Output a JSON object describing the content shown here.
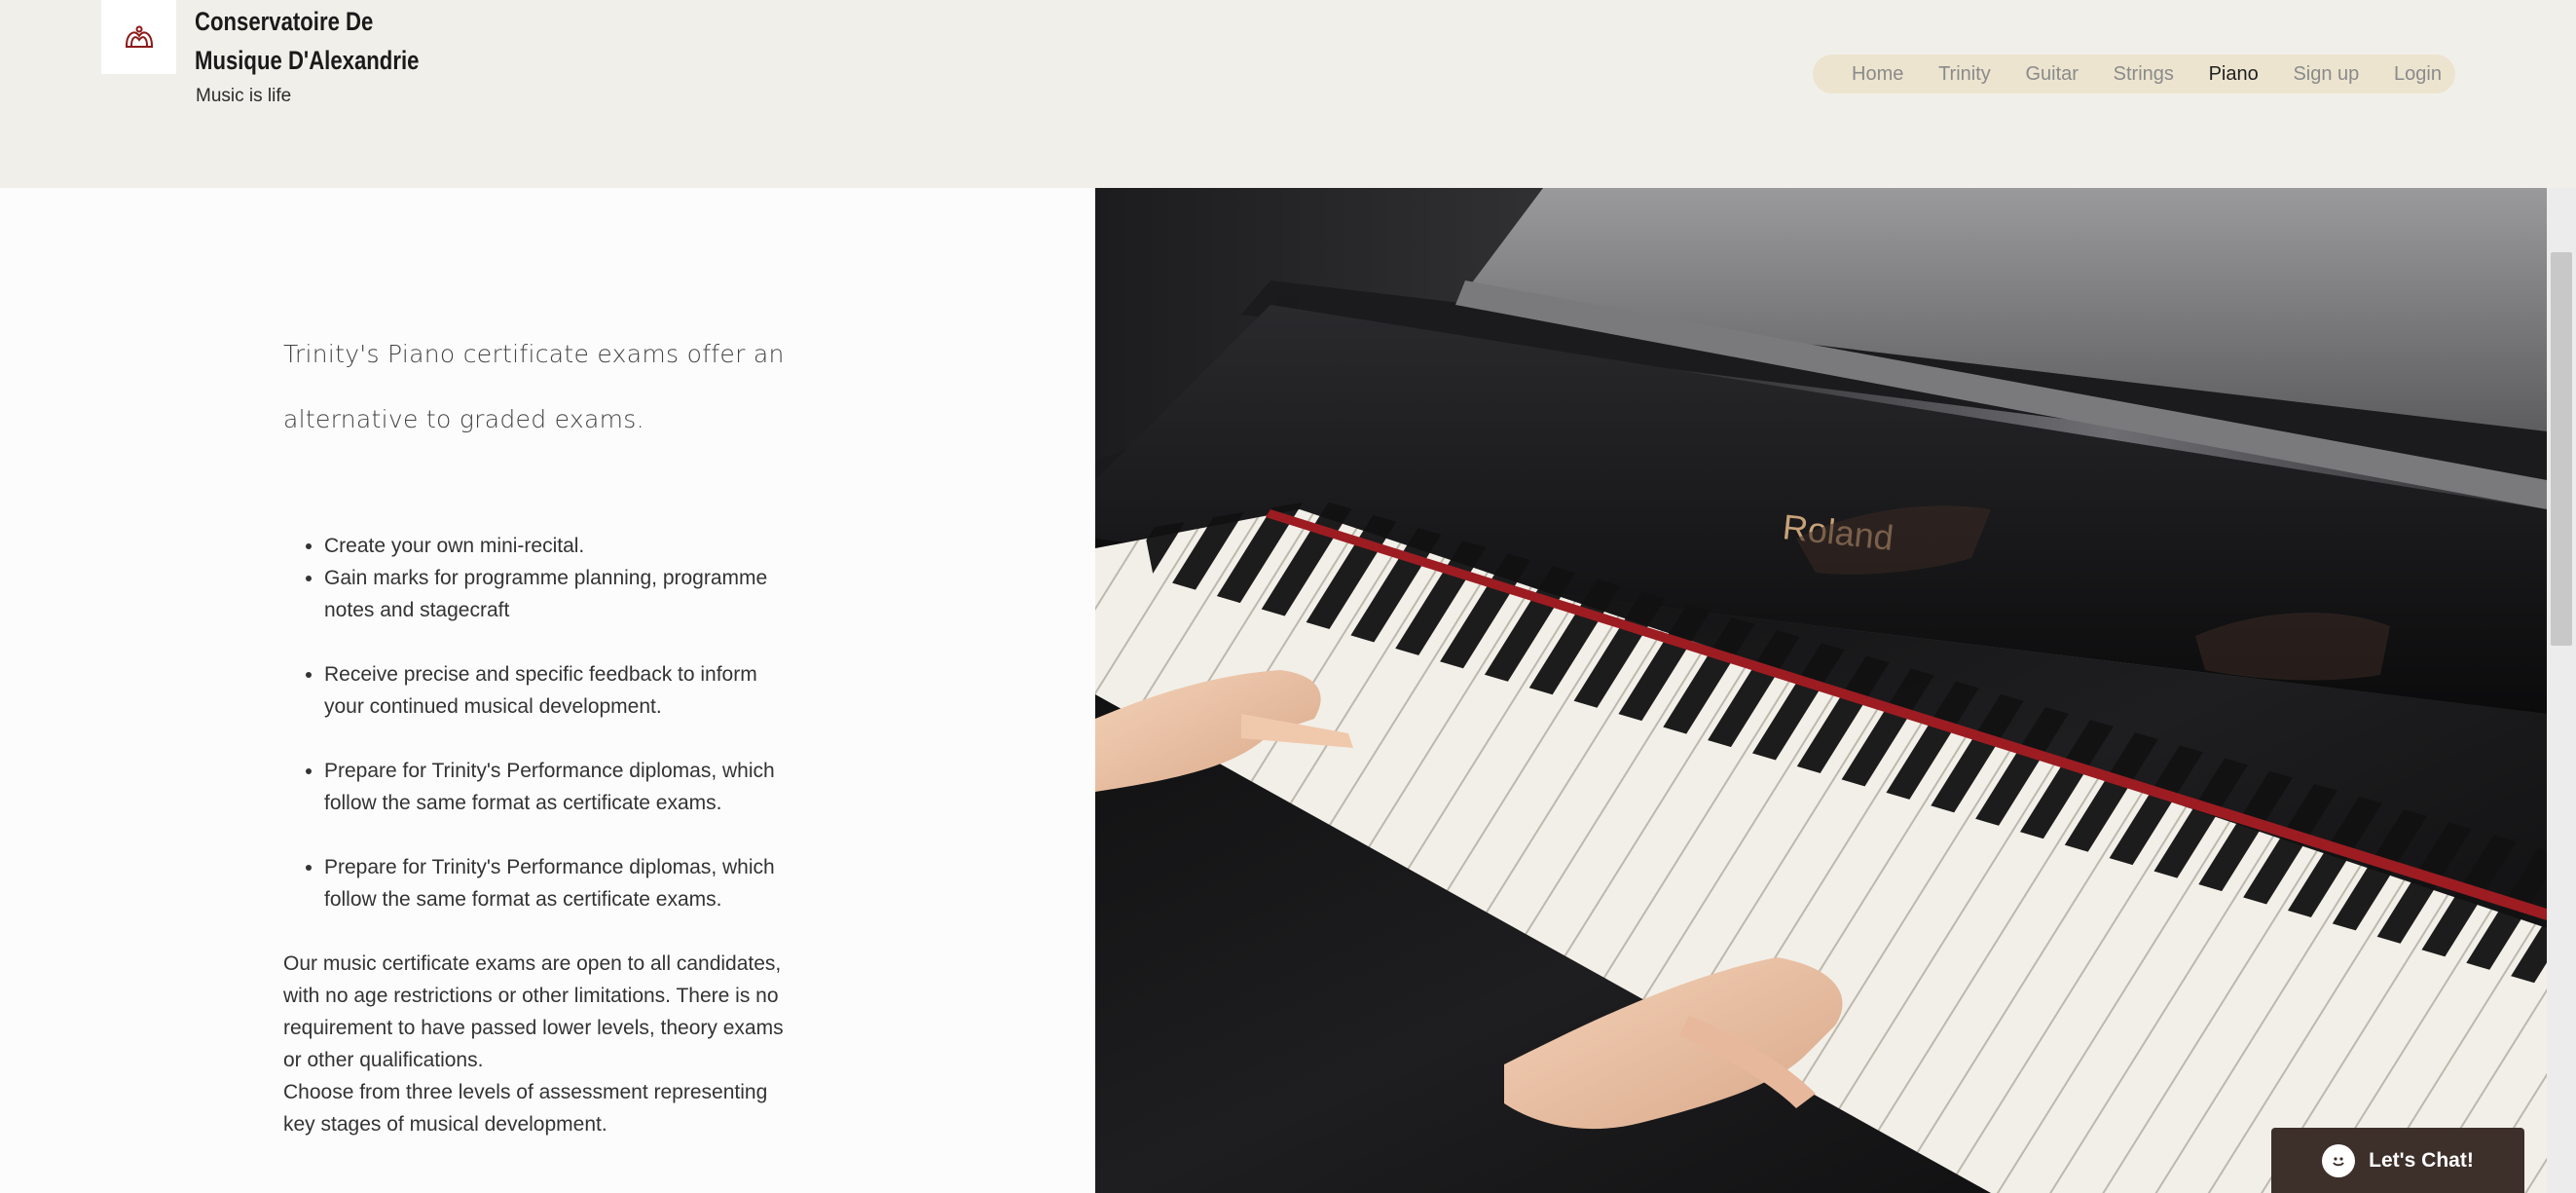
{
  "header": {
    "title_line1": "Conservatoire De",
    "title_line2": "Musique D'Alexandrie",
    "tagline": "Music is life",
    "logo_icon": "harp-logo-icon"
  },
  "nav": {
    "items": [
      {
        "label": "Home",
        "active": false
      },
      {
        "label": "Trinity",
        "active": false
      },
      {
        "label": "Guitar",
        "active": false
      },
      {
        "label": "Strings",
        "active": false
      },
      {
        "label": "Piano",
        "active": true
      },
      {
        "label": "Sign up",
        "active": false
      },
      {
        "label": "Login",
        "active": false
      }
    ]
  },
  "main": {
    "lead_line1": "Trinity's Piano certificate exams offer an",
    "lead_line2": "alternative to graded exams.",
    "bullets": [
      "Create your own mini-recital.",
      "Gain marks for programme planning, programme notes and stagecraft",
      "Receive precise and specific feedback to inform your continued musical development.",
      "Prepare for Trinity's Performance diplomas, which follow the same format as certificate exams.",
      "Prepare for Trinity's Performance diplomas, which follow the same format as certificate exams."
    ],
    "paragraph1": "Our music certificate exams are open to all candidates, with no age restrictions or other limitations. There is no requirement to have passed lower levels, theory exams or other qualifications.",
    "paragraph2": "Choose from three levels of assessment representing key stages of musical development.",
    "hero_brand": "Roland"
  },
  "chat": {
    "label": "Let's Chat!",
    "icon": "chat-smile-icon"
  },
  "colors": {
    "header_bg": "#f1efe9",
    "nav_pill": "#ece4cf",
    "chat_bg": "#3d2f2a",
    "logo_red": "#8b1a1a"
  }
}
